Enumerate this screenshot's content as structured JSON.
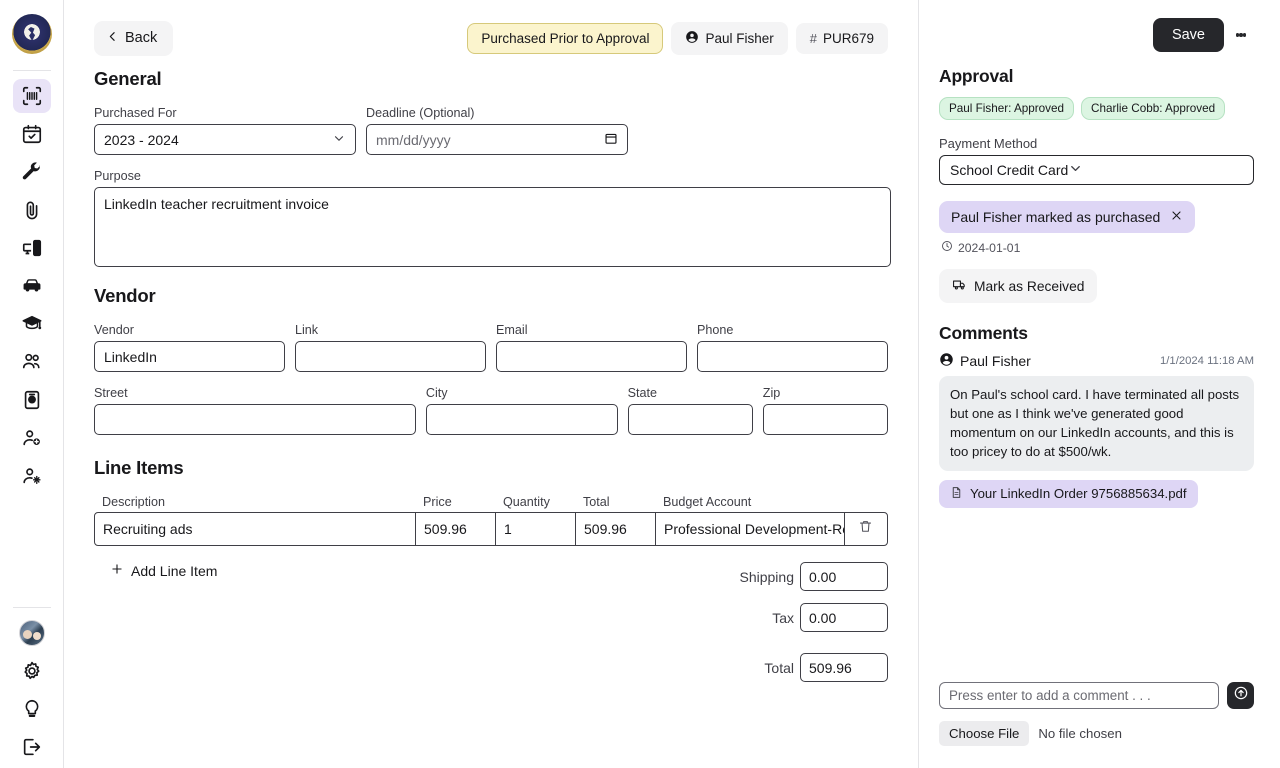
{
  "sidebar": {
    "logo_alt": "Capstone school crest",
    "items": [
      {
        "icon": "barcode-scan-icon",
        "name": "purchasing",
        "active": true
      },
      {
        "icon": "calendar-check-icon",
        "name": "calendar",
        "active": false
      },
      {
        "icon": "wrench-icon",
        "name": "maintenance",
        "active": false
      },
      {
        "icon": "paperclip-icon",
        "name": "attachments",
        "active": false
      },
      {
        "icon": "desktop-computer-icon",
        "name": "technology",
        "active": false
      },
      {
        "icon": "car-icon",
        "name": "transportation",
        "active": false
      },
      {
        "icon": "graduation-cap-icon",
        "name": "academics",
        "active": false
      },
      {
        "icon": "users-icon",
        "name": "people",
        "active": false
      },
      {
        "icon": "id-badge-icon",
        "name": "directory",
        "active": false
      },
      {
        "icon": "user-plus-icon",
        "name": "add-user",
        "active": false
      },
      {
        "icon": "user-settings-icon",
        "name": "user-settings",
        "active": false
      }
    ],
    "footer_items": [
      {
        "icon": "user-avatar",
        "name": "profile"
      },
      {
        "icon": "gear-icon",
        "name": "settings"
      },
      {
        "icon": "lightbulb-icon",
        "name": "tips"
      },
      {
        "icon": "logout-icon",
        "name": "logout"
      }
    ]
  },
  "topbar": {
    "back_label": "Back",
    "status_chip": "Purchased Prior to Approval",
    "requester_chip": "Paul Fisher",
    "id_chip": "PUR679",
    "id_prefix": "#"
  },
  "general": {
    "heading": "General",
    "purchased_for_label": "Purchased For",
    "purchased_for_value": "2023 - 2024",
    "deadline_label": "Deadline (Optional)",
    "deadline_placeholder": "mm/dd/yyyy",
    "purpose_label": "Purpose",
    "purpose_value": "LinkedIn teacher recruitment invoice"
  },
  "vendor": {
    "heading": "Vendor",
    "fields": [
      {
        "label": "Vendor",
        "value": "LinkedIn"
      },
      {
        "label": "Link",
        "value": ""
      },
      {
        "label": "Email",
        "value": ""
      },
      {
        "label": "Phone",
        "value": ""
      }
    ],
    "address_fields": [
      {
        "label": "Street",
        "value": ""
      },
      {
        "label": "City",
        "value": ""
      },
      {
        "label": "State",
        "value": ""
      },
      {
        "label": "Zip",
        "value": ""
      }
    ]
  },
  "line_items": {
    "heading": "Line Items",
    "columns": [
      "Description",
      "Price",
      "Quantity",
      "Total",
      "Budget Account"
    ],
    "rows": [
      {
        "description": "Recruiting ads",
        "price": "509.96",
        "quantity": "1",
        "total": "509.96",
        "budget_account": "Professional Development-Recr"
      }
    ],
    "add_label": "Add Line Item",
    "totals": [
      {
        "label": "Shipping",
        "value": "0.00"
      },
      {
        "label": "Tax",
        "value": "0.00"
      },
      {
        "label": "Total",
        "value": "509.96"
      }
    ]
  },
  "approval": {
    "heading": "Approval",
    "approvers": [
      "Paul Fisher: Approved",
      "Charlie Cobb: Approved"
    ],
    "payment_method_label": "Payment Method",
    "payment_method_value": "School Credit Card",
    "purchased_pill": "Paul Fisher marked as purchased",
    "purchased_date": "2024-01-01",
    "mark_received_label": "Mark as Received"
  },
  "comments": {
    "heading": "Comments",
    "items": [
      {
        "author": "Paul Fisher",
        "timestamp": "1/1/2024 11:18 AM",
        "body": "On Paul's school card. I have terminated all posts but one as I think we've generated good momentum on our LinkedIn accounts, and this is too pricey to do at $500/wk.",
        "attachment": "Your LinkedIn Order 9756885634.pdf"
      }
    ],
    "input_placeholder": "Press enter to add a comment . . .",
    "choose_file_label": "Choose File",
    "no_file_label": "No file chosen"
  },
  "actions": {
    "save_label": "Save"
  },
  "colors": {
    "accent_purple": "#ded6f5",
    "warn_yellow": "#fbf4cd",
    "approved_green": "#dcf5e2",
    "dark": "#26272b"
  }
}
